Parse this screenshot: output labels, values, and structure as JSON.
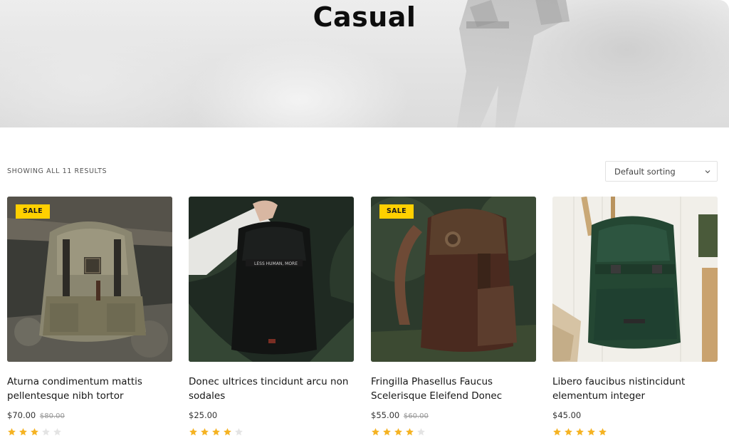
{
  "hero": {
    "title": "Casual"
  },
  "toolbar": {
    "result_count": "SHOWING ALL 11 RESULTS",
    "sort_label": "Default sorting",
    "sort_icon": "chevron-down-icon"
  },
  "colors": {
    "sale_badge": "#ffd000",
    "star_filled": "#f5b323",
    "star_empty": "#e4e4e4"
  },
  "products": [
    {
      "title": "Aturna condimentum mattis pellentesque nibh tortor",
      "price": "$70.00",
      "old_price": "$80.00",
      "badge": "SALE",
      "rating": 3
    },
    {
      "title": "Donec ultrices tincidunt arcu non sodales",
      "price": "$25.00",
      "old_price": "",
      "badge": "",
      "rating": 4
    },
    {
      "title": "Fringilla Phasellus Faucus Scelerisque Eleifend Donec",
      "price": "$55.00",
      "old_price": "$60.00",
      "badge": "SALE",
      "rating": 4
    },
    {
      "title": "Libero faucibus nistincidunt elementum integer",
      "price": "$45.00",
      "old_price": "",
      "badge": "",
      "rating": 5
    }
  ]
}
